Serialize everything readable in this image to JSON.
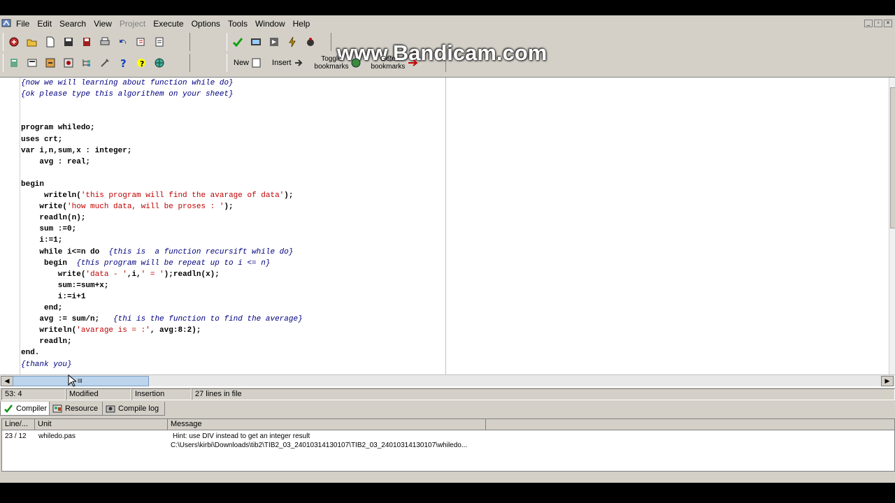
{
  "menu": {
    "items": [
      {
        "label": "File",
        "enabled": true
      },
      {
        "label": "Edit",
        "enabled": true
      },
      {
        "label": "Search",
        "enabled": true
      },
      {
        "label": "View",
        "enabled": true
      },
      {
        "label": "Project",
        "enabled": false
      },
      {
        "label": "Execute",
        "enabled": true
      },
      {
        "label": "Options",
        "enabled": true
      },
      {
        "label": "Tools",
        "enabled": true
      },
      {
        "label": "Window",
        "enabled": true
      },
      {
        "label": "Help",
        "enabled": true
      }
    ]
  },
  "toolbar": {
    "new_label": "New",
    "insert_label": "Insert",
    "toggle_line1": "Toggle",
    "toggle_line2": "bookmarks",
    "goto_line1": "Goto",
    "goto_line2": "bookmarks"
  },
  "watermark": "www.Bandicam.com",
  "editor": {
    "lines": [
      [
        {
          "t": "{now we will learning about function while do}",
          "c": "cmt"
        }
      ],
      [
        {
          "t": "{ok please type this algorithem on your sheet}",
          "c": "cmt"
        }
      ],
      [],
      [],
      [
        {
          "t": "program whiledo;",
          "c": "kw"
        }
      ],
      [
        {
          "t": "uses crt;",
          "c": "kw"
        }
      ],
      [
        {
          "t": "var i,n,sum,x : integer;",
          "c": "kw"
        }
      ],
      [
        {
          "t": "    avg : real;",
          "c": "kw"
        }
      ],
      [],
      [
        {
          "t": "begin",
          "c": "kw"
        }
      ],
      [
        {
          "t": "     writeln(",
          "c": "kw"
        },
        {
          "t": "'this program will find the avarage of data'",
          "c": "str"
        },
        {
          "t": ");",
          "c": "kw"
        }
      ],
      [
        {
          "t": "    write(",
          "c": "kw"
        },
        {
          "t": "'how much data, will be proses : '",
          "c": "str"
        },
        {
          "t": ");",
          "c": "kw"
        }
      ],
      [
        {
          "t": "    readln(n);",
          "c": "kw"
        }
      ],
      [
        {
          "t": "    sum :=0;",
          "c": "kw"
        }
      ],
      [
        {
          "t": "    i:=1;",
          "c": "kw"
        }
      ],
      [
        {
          "t": "    while i<=n do  ",
          "c": "kw"
        },
        {
          "t": "{this is  a function recursift while do}",
          "c": "cmt"
        }
      ],
      [
        {
          "t": "     begin  ",
          "c": "kw"
        },
        {
          "t": "{this program will be repeat up to i <= n}",
          "c": "cmt"
        }
      ],
      [
        {
          "t": "        write(",
          "c": "kw"
        },
        {
          "t": "'data - '",
          "c": "str"
        },
        {
          "t": ",i,",
          "c": "kw"
        },
        {
          "t": "' = '",
          "c": "str"
        },
        {
          "t": ");readln(x);",
          "c": "kw"
        }
      ],
      [
        {
          "t": "        sum:=sum+x;",
          "c": "kw"
        }
      ],
      [
        {
          "t": "        i:=i+1",
          "c": "kw"
        }
      ],
      [
        {
          "t": "     end;",
          "c": "kw"
        }
      ],
      [
        {
          "t": "    avg := sum/n;   ",
          "c": "kw"
        },
        {
          "t": "{thi is the function to find the average}",
          "c": "cmt"
        }
      ],
      [
        {
          "t": "    writeln(",
          "c": "kw"
        },
        {
          "t": "'avarage is = :'",
          "c": "str"
        },
        {
          "t": ", avg:8:2);",
          "c": "kw"
        }
      ],
      [
        {
          "t": "    readln;",
          "c": "kw"
        }
      ],
      [
        {
          "t": "end.",
          "c": "kw"
        }
      ],
      [
        {
          "t": "{thank you}",
          "c": "cmt"
        }
      ]
    ]
  },
  "hscroll_thumb_glyph": "III",
  "status": {
    "position": "53: 4",
    "modified": "Modified",
    "mode": "Insertion",
    "lines": "27 lines in file"
  },
  "tabs": [
    {
      "label": "Compiler",
      "icon": "check-icon"
    },
    {
      "label": "Resource",
      "icon": "resource-icon"
    },
    {
      "label": "Compile log",
      "icon": "compile-log-icon"
    }
  ],
  "messages": {
    "columns": [
      "Line/...",
      "Unit",
      "Message"
    ],
    "rows": [
      {
        "line": "23 / 12",
        "unit": "whiledo.pas",
        "message": "Hint: use DIV instead to get an integer result",
        "detail": "C:\\Users\\kirbi\\Downloads\\tib2\\TIB2_03_24010314130107\\TIB2_03_24010314130107\\whiledo..."
      }
    ]
  },
  "colors": {
    "keyword": "#000000",
    "string": "#c00000",
    "comment": "#000080",
    "chrome": "#d4d0c8"
  }
}
